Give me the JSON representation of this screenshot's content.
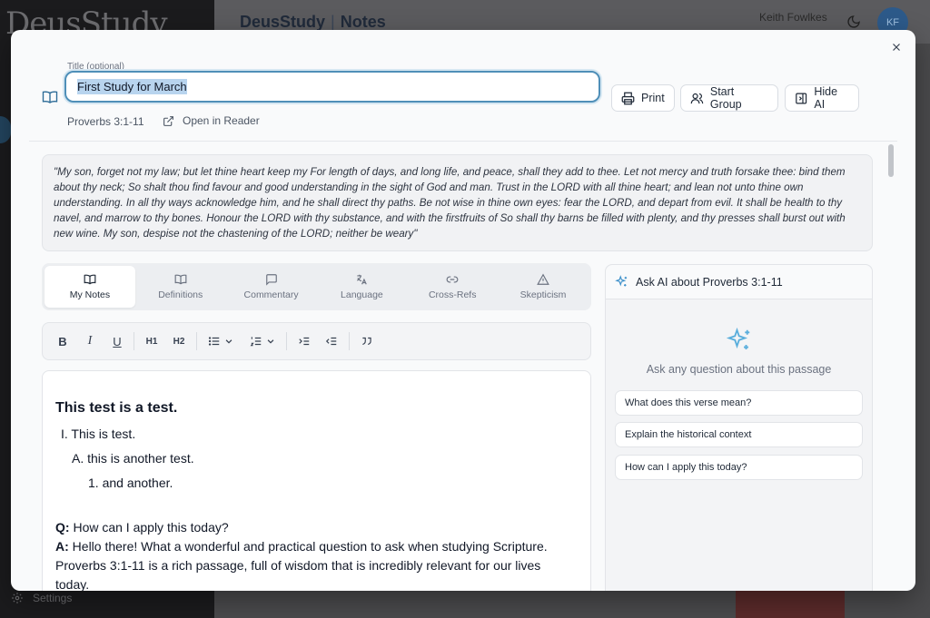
{
  "background": {
    "logo": "DeusStudy",
    "header_app": "DeusStudy",
    "header_page": "Notes",
    "user_name": "Keith Fowlkes",
    "avatar_initials": "KF",
    "settings_label": "Settings"
  },
  "modal": {
    "title_label": "Title (optional)",
    "title_value": "First Study for March",
    "buttons": {
      "print": "Print",
      "start_group": "Start Group",
      "hide_ai": "Hide AI"
    },
    "reference": "Proverbs 3:1-11",
    "open_in_reader": "Open in Reader",
    "passage": "\"My son, forget not my law; but let thine heart keep my For length of days, and long life, and peace, shall they add to thee. Let not mercy and truth forsake thee: bind them about thy neck; So shalt thou find favour and good understanding in the sight of God and man. Trust in the LORD with all thine heart; and lean not unto thine own understanding. In all thy ways acknowledge him, and he shall direct thy paths. Be not wise in thine own eyes: fear the LORD, and depart from evil. It shall be health to thy navel, and marrow to thy bones. Honour the LORD with thy substance, and with the firstfruits of So shall thy barns be filled with plenty, and thy presses shall burst out with new wine. My son, despise not the chastening of the LORD; neither be weary\"",
    "tabs": [
      {
        "label": "My Notes",
        "icon": "book-open-icon"
      },
      {
        "label": "Definitions",
        "icon": "book-icon"
      },
      {
        "label": "Commentary",
        "icon": "message-square-icon"
      },
      {
        "label": "Language",
        "icon": "languages-icon"
      },
      {
        "label": "Cross-Refs",
        "icon": "link-icon"
      },
      {
        "label": "Skepticism",
        "icon": "alert-triangle-icon"
      }
    ],
    "toolbar": {
      "bold": "B",
      "italic": "I",
      "underline": "U",
      "h1": "H1",
      "h2": "H2"
    },
    "editor": {
      "heading": "This test is a test.",
      "item1": "I. This is test.",
      "item2": "A. this is another test.",
      "item3": "1. and another.",
      "q_label": "Q:",
      "q_text": " How can I apply this today?",
      "a_label": "A:",
      "a_text": " Hello there! What a wonderful and practical question to ask when studying Scripture. Proverbs 3:1-11 is a rich passage, full of wisdom that is incredibly relevant for our lives today."
    },
    "ai": {
      "header": "Ask AI about Proverbs 3:1-11",
      "hint": "Ask any question about this passage",
      "suggestions": [
        "What does this verse mean?",
        "Explain the historical context",
        "How can I apply this today?"
      ]
    }
  }
}
